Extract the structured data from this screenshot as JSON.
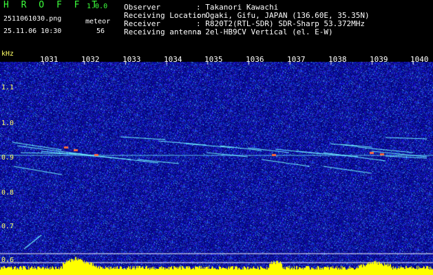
{
  "header": {
    "app_title": "H R O F F T",
    "app_version": "1.0.0",
    "filename": "2511061030.png",
    "datetime": "25.11.06 10:30",
    "meteor_label": "meteor",
    "meteor_count": "56",
    "meta": [
      {
        "key": "Observer",
        "value": ": Takanori Kawachi"
      },
      {
        "key": "Receiving Location",
        "value": ": Ogaki, Gifu, JAPAN (136.60E, 35.35N)"
      },
      {
        "key": "Receiver",
        "value": ": R820T2(RTL-SDR) SDR-Sharp 53.372MHz"
      },
      {
        "key": "Receiving antenna",
        "value": ": 2el-HB9CV Vertical (el. E-W)"
      }
    ]
  },
  "plot": {
    "y_unit": "kHz",
    "y_ticks": [
      "1.1",
      "1.0",
      "0.9",
      "0.8",
      "0.7",
      "0.6"
    ],
    "x_ticks": [
      "1031",
      "1032",
      "1033",
      "1034",
      "1035",
      "1036",
      "1037",
      "1038",
      "1039",
      "1040"
    ],
    "colors": {
      "background": "#0a0a8a",
      "noise": "#3c5cff",
      "echo": "#6ff0ff",
      "hot": "#ff6a3c",
      "spectrum": "#ffff00"
    }
  }
}
